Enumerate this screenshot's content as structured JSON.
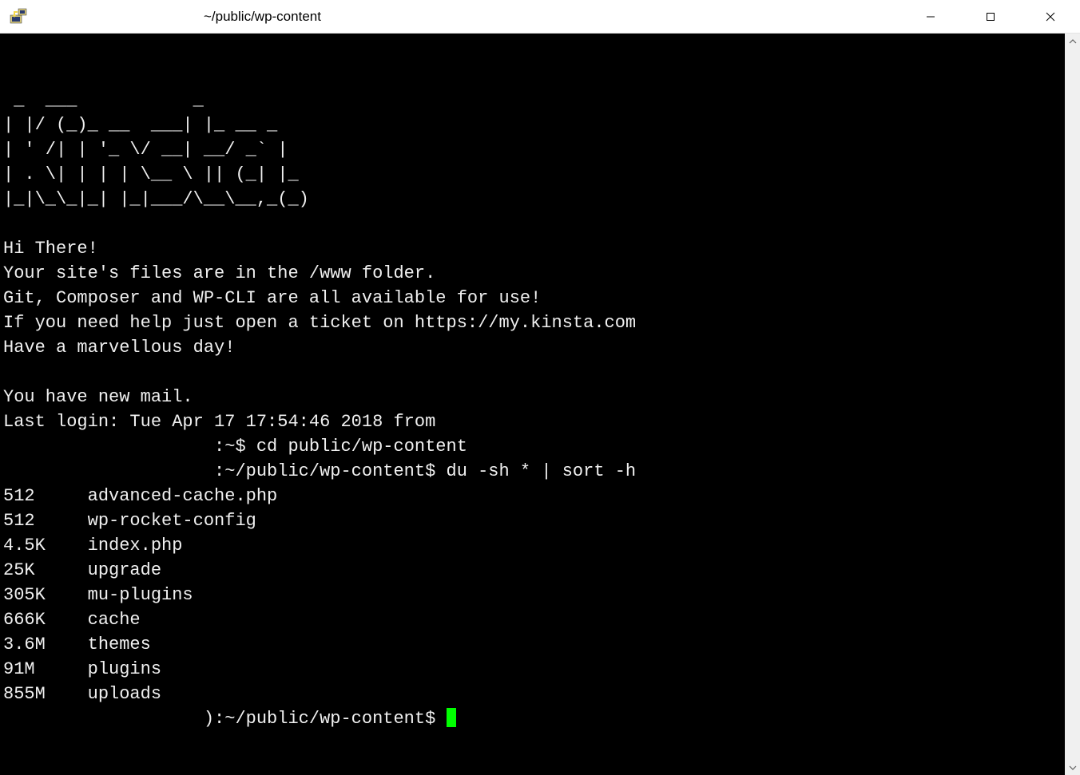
{
  "window": {
    "title": "~/public/wp-content"
  },
  "ascii": {
    "l1": " _  ___           _",
    "l2": "| |/ (_)_ __  ___| |_ __ _",
    "l3": "| ' /| | '_ \\/ __| __/ _` |",
    "l4": "| . \\| | | | \\__ \\ || (_| |_",
    "l5": "|_|\\_\\_|_| |_|___/\\__\\__,_(_)"
  },
  "motd": {
    "greeting": "Hi There!",
    "line1": "Your site's files are in the /www folder.",
    "line2": "Git, Composer and WP-CLI are all available for use!",
    "line3": "If you need help just open a ticket on https://my.kinsta.com",
    "line4": "Have a marvellous day!"
  },
  "session": {
    "mail": "You have new mail.",
    "last_login": "Last login: Tue Apr 17 17:54:46 2018 from",
    "prompt1_prefix": "                    :~$ ",
    "cmd1": "cd public/wp-content",
    "prompt2_prefix": "                    :~/public/wp-content$ ",
    "cmd2": "du -sh * | sort -h",
    "prompt3_prefix": "                   ):~/public/wp-content$ "
  },
  "du_output": [
    {
      "size": "512",
      "name": "advanced-cache.php"
    },
    {
      "size": "512",
      "name": "wp-rocket-config"
    },
    {
      "size": "4.5K",
      "name": "index.php"
    },
    {
      "size": "25K",
      "name": "upgrade"
    },
    {
      "size": "305K",
      "name": "mu-plugins"
    },
    {
      "size": "666K",
      "name": "cache"
    },
    {
      "size": "3.6M",
      "name": "themes"
    },
    {
      "size": "91M",
      "name": "plugins"
    },
    {
      "size": "855M",
      "name": "uploads"
    }
  ]
}
